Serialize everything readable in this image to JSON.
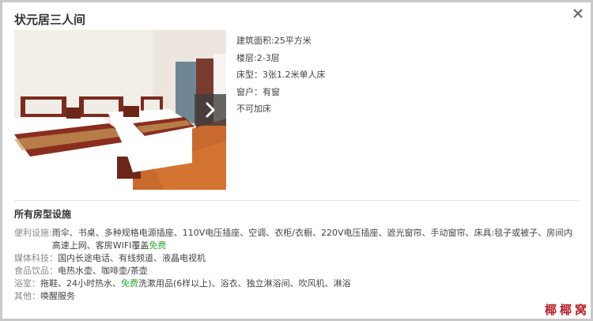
{
  "dialog": {
    "title": "状元居三人间",
    "close_icon": "close-icon",
    "next_icon": "chevron-right-icon"
  },
  "room_info": [
    "建筑面积:25平方米",
    "楼层:2-3层",
    "床型：3张1.2米单人床",
    "窗户：有窗",
    "不可加床"
  ],
  "facilities": {
    "heading": "所有房型设施",
    "convenience": {
      "label": "便利设施:",
      "text": "雨伞、书桌、多种规格电源插座、110V电压插座、空调、衣柜/衣橱、220V电压插座、遮光窗帘、手动窗帘、床具:毯子或被子、房间内高速上网、客房WIFI覆盖",
      "free": "免费"
    },
    "media": {
      "label": "媒体科技：",
      "text": "国内长途电话、有线频道、液晶电视机"
    },
    "food": {
      "label": "食品饮品：",
      "text": "电热水壶、咖啡壶/茶壶"
    },
    "bathroom": {
      "label": "浴室：",
      "pre": "拖鞋、24小时热水、",
      "free": "免费",
      "post": "洗漱用品(6样以上)、浴衣、独立淋浴间、吹风机、淋浴"
    },
    "other": {
      "label": "其他：",
      "text": "唤醒服务"
    }
  },
  "watermark": "椰椰窝",
  "colors": {
    "free_green": "#2eaa3b",
    "watermark_red": "#b8232a"
  }
}
